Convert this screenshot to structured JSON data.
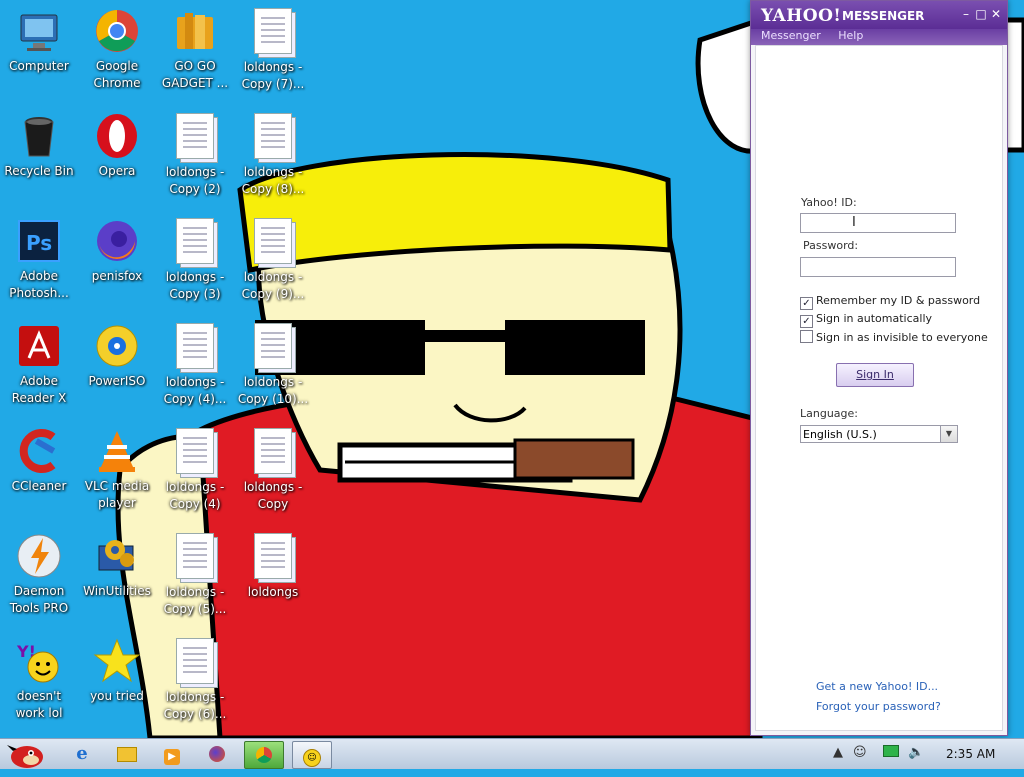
{
  "desktop": {
    "icons": [
      {
        "label": "Computer",
        "icon": "computer-icon"
      },
      {
        "label": "Google\nChrome",
        "icon": "chrome-icon"
      },
      {
        "label": "GO GO\nGADGET ...",
        "icon": "folder-icon"
      },
      {
        "label": "loldongs -\nCopy (7)...",
        "icon": "document-icon"
      },
      {
        "label": "Recycle Bin",
        "icon": "recycle-bin-icon"
      },
      {
        "label": "Opera",
        "icon": "opera-icon"
      },
      {
        "label": "loldongs -\nCopy (2)",
        "icon": "document-icon"
      },
      {
        "label": "loldongs -\nCopy (8)...",
        "icon": "document-icon"
      },
      {
        "label": "Adobe\nPhotosh...",
        "icon": "photoshop-icon"
      },
      {
        "label": "penisfox",
        "icon": "firefox-icon"
      },
      {
        "label": "loldongs -\nCopy (3)",
        "icon": "document-icon"
      },
      {
        "label": "loldongs -\nCopy (9)...",
        "icon": "document-icon"
      },
      {
        "label": "Adobe\nReader X",
        "icon": "adobe-reader-icon"
      },
      {
        "label": "PowerISO",
        "icon": "poweriso-icon"
      },
      {
        "label": "loldongs -\nCopy (4)...",
        "icon": "document-icon"
      },
      {
        "label": "loldongs -\nCopy (10)...",
        "icon": "document-icon"
      },
      {
        "label": "CCleaner",
        "icon": "ccleaner-icon"
      },
      {
        "label": "VLC media\nplayer",
        "icon": "vlc-icon"
      },
      {
        "label": "loldongs -\nCopy (4)",
        "icon": "document-icon"
      },
      {
        "label": "loldongs -\nCopy",
        "icon": "document-icon"
      },
      {
        "label": "Daemon\nTools PRO",
        "icon": "daemon-tools-icon"
      },
      {
        "label": "WinUtilities",
        "icon": "winutilities-icon"
      },
      {
        "label": "loldongs -\nCopy (5)...",
        "icon": "document-icon"
      },
      {
        "label": "loldongs",
        "icon": "document-icon"
      },
      {
        "label": "doesn't\nwork lol",
        "icon": "yahoo-messenger-icon"
      },
      {
        "label": "you tried",
        "icon": "star-icon"
      },
      {
        "label": "loldongs -\nCopy (6)...",
        "icon": "document-icon"
      }
    ]
  },
  "messenger": {
    "brand": "YAHOO!",
    "product": "MESSENGER",
    "menu": [
      "Messenger",
      "Help"
    ],
    "yahoo_id_label": "Yahoo! ID:",
    "yahoo_id_value": "",
    "password_label": "Password:",
    "password_value": "",
    "remember_label": "Remember my ID & password",
    "remember_checked": true,
    "auto_label": "Sign in automatically",
    "auto_checked": true,
    "invisible_label": "Sign in as invisible to everyone",
    "invisible_checked": false,
    "signin_label": "Sign In",
    "language_label": "Language:",
    "language_value": "English (U.S.)",
    "new_id_link": "Get a new Yahoo! ID...",
    "forgot_link": "Forgot your password?",
    "accent": "#6a3fa3"
  },
  "taskbar": {
    "items": [
      "start-orb-icon",
      "internet-explorer-icon",
      "folder-icon",
      "media-player-icon",
      "firefox-icon",
      "chrome-icon",
      "yahoo-messenger-icon"
    ],
    "clock": "2:35 AM"
  }
}
